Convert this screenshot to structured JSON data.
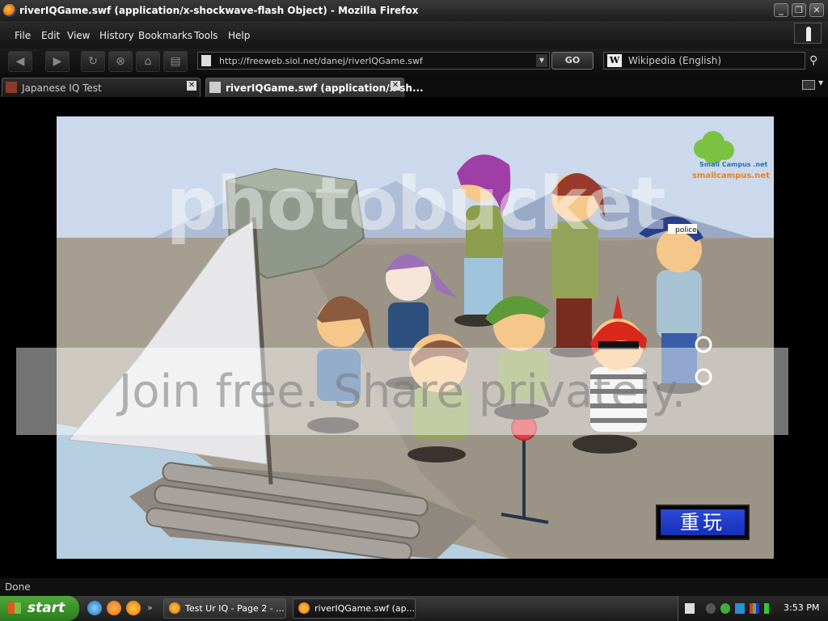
{
  "window": {
    "title": "riverIQGame.swf (application/x-shockwave-flash Object) - Mozilla Firefox",
    "minimize_icon": "minimize-icon",
    "restore_icon": "restore-icon",
    "close_icon": "close-icon"
  },
  "menu": {
    "items": [
      "File",
      "Edit",
      "View",
      "History",
      "Bookmarks",
      "Tools",
      "Help"
    ]
  },
  "nav": {
    "back_icon": "back-arrow-icon",
    "forward_icon": "forward-arrow-icon",
    "reload_icon": "reload-icon",
    "stop_icon": "stop-icon",
    "home_icon": "home-icon",
    "bookmarks_icon": "bookmarks-icon",
    "url": "http://freeweb.siol.net/danej/riverIQGame.swf",
    "go_label": "GO",
    "search_engine": "Wikipedia (English)",
    "search_icon": "magnifier-icon"
  },
  "tabs": [
    {
      "title": "Japanese IQ Test",
      "active": false
    },
    {
      "title": "riverIQGame.swf (application/x-sh...",
      "active": true
    }
  ],
  "game": {
    "logo": "smallcampus.net",
    "police_cap_label": "police",
    "replay_label": "重玩",
    "watermark_top": "photobucket",
    "watermark_band": "Join free. Share privately."
  },
  "status": {
    "text": "Done"
  },
  "taskbar": {
    "start_label": "start",
    "buttons": [
      {
        "label": "Test Ur IQ - Page 2 - ..."
      },
      {
        "label": "riverIQGame.swf (ap..."
      }
    ],
    "clock": "3:53 PM"
  },
  "colors": {
    "sky": "#ccd9ec",
    "ground": "#a59d8f",
    "water": "#b6cfe0",
    "replay_blue": "#1f3fd0",
    "start_green": "#3b8f2a"
  }
}
